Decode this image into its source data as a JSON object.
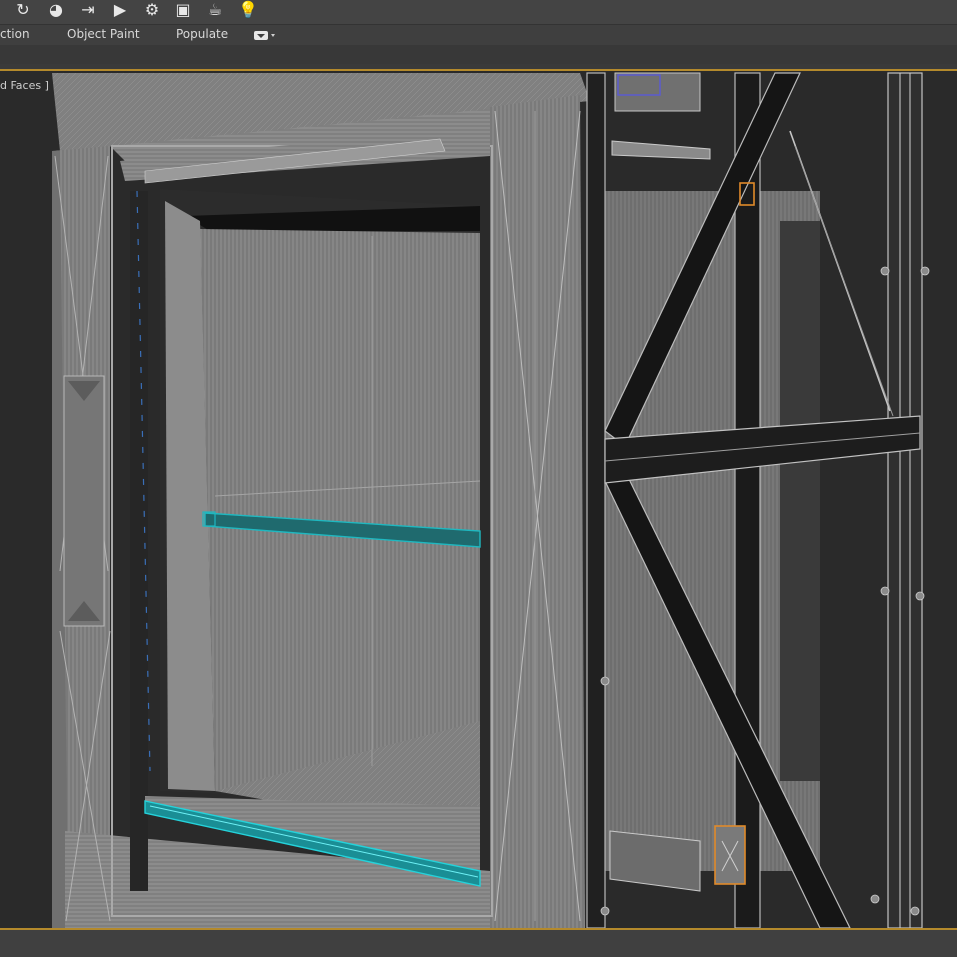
{
  "toolbar": {
    "icons": [
      {
        "name": "rotate-icon",
        "glyph": "↻"
      },
      {
        "name": "material-editor-icon",
        "glyph": "◕"
      },
      {
        "name": "set-key-icon",
        "glyph": "⇥"
      },
      {
        "name": "play-render-icon",
        "glyph": "▶"
      },
      {
        "name": "render-setup-icon",
        "glyph": "⚙"
      },
      {
        "name": "frame-window-icon",
        "glyph": "▣"
      },
      {
        "name": "teapot-icon",
        "glyph": "☕"
      },
      {
        "name": "light-bulb-icon",
        "glyph": "💡"
      }
    ]
  },
  "ribbon": {
    "tabs": [
      "ction",
      "Object Paint",
      "Populate"
    ]
  },
  "viewport": {
    "label": "d Faces ]"
  },
  "colors": {
    "accent_border": "#b48a2c",
    "selection_cyan": "#1fb8c0",
    "wire": "#8f8f8f",
    "orange_highlight": "#e08a2a"
  }
}
